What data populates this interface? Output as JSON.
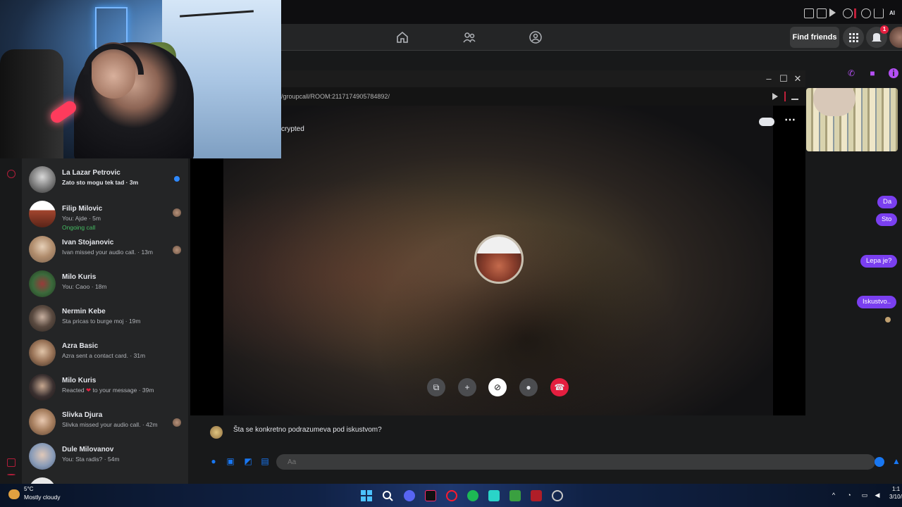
{
  "browser": {
    "title": "AI",
    "extension_icons": [
      "pin-icon",
      "tab-icon",
      "play-icon",
      "recording-icon",
      "download-icon",
      "profile-icon",
      "heart-icon"
    ]
  },
  "facebook_nav": {
    "find_friends_label": "Find friends",
    "notification_count": "1",
    "icons": [
      "home-icon",
      "friends-icon",
      "groups-icon",
      "menu-grid-icon",
      "bell-icon"
    ]
  },
  "chat_list": {
    "items": [
      {
        "name": "La Lazar Petrovic",
        "preview": "Zato sto mogu tek tad · 3m",
        "status": "",
        "unread": true
      },
      {
        "name": "Filip Milovic",
        "preview": "You: Ajde · 5m",
        "status": "Ongoing call",
        "unread": false
      },
      {
        "name": "Ivan Stojanovic",
        "preview": "Ivan missed your audio call. · 13m",
        "status": "",
        "unread": false
      },
      {
        "name": "Milo Kuris",
        "preview": "You: Caoo · 18m",
        "status": "",
        "unread": false
      },
      {
        "name": "Nermin Kebe",
        "preview": "Sta pricas to burge moj · 19m",
        "status": "",
        "unread": false
      },
      {
        "name": "Azra Basic",
        "preview": "Azra sent a contact card. · 31m",
        "status": "",
        "unread": false
      },
      {
        "name": "Milo Kuris",
        "preview_before": "Reacted ",
        "preview_heart": "❤",
        "preview_after": " to your message · 39m",
        "status": "",
        "unread": false
      },
      {
        "name": "Slivka Djura",
        "preview": "Slivka missed your audio call. · 42m",
        "status": "",
        "unread": false
      },
      {
        "name": "Dule Milovanov",
        "preview": "You: Sta radis? · 54m",
        "status": "",
        "unread": false
      }
    ]
  },
  "call_window": {
    "url": "/groupcall/ROOM:2117174905784892/",
    "encryption_label": "crypted",
    "controls": [
      "share-screen",
      "add-person",
      "camera-off",
      "microphone",
      "end-call"
    ]
  },
  "conversation": {
    "sent_messages": [
      "Da",
      "Sto",
      "Lepa je?",
      "Iskustvo.."
    ],
    "received_message": "Šta se konkretno podrazumeva pod iskustvom?",
    "composer_placeholder": "Aa"
  },
  "taskbar": {
    "temperature": "5°C",
    "weather": "Mostly cloudy",
    "time": "1:1",
    "date": "3/10/"
  },
  "colors": {
    "messenger_purple": "#7a3ff0",
    "facebook_blue": "#1877f2",
    "end_call_red": "#e41e3f",
    "online_green": "#45bd62"
  }
}
